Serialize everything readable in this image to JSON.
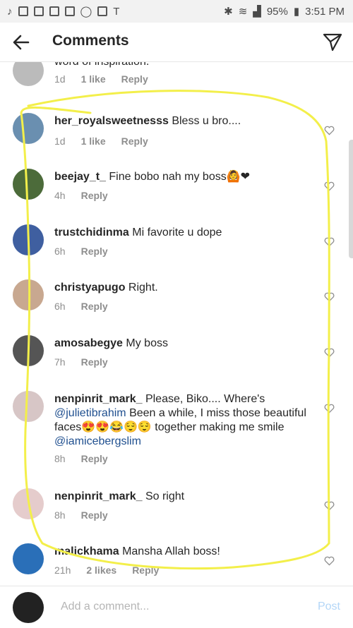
{
  "status_bar": {
    "battery": "95%",
    "time": "3:51 PM"
  },
  "header": {
    "title": "Comments"
  },
  "comments": [
    {
      "user": "",
      "text": "word of inspiration.",
      "time": "1d",
      "likes": "1 like",
      "reply": "Reply"
    },
    {
      "user": "her_royalsweetnesss",
      "text": "Bless u bro....",
      "time": "1d",
      "likes": "1 like",
      "reply": "Reply"
    },
    {
      "user": "beejay_t_",
      "text": "Fine bobo nah my boss🙆❤",
      "time": "4h",
      "likes": "",
      "reply": "Reply"
    },
    {
      "user": "trustchidinma",
      "text": "Mi favorite u dope",
      "time": "6h",
      "likes": "",
      "reply": "Reply"
    },
    {
      "user": "christyapugo",
      "text": "Right.",
      "time": "6h",
      "likes": "",
      "reply": "Reply"
    },
    {
      "user": "amosabegye",
      "text": "My boss",
      "time": "7h",
      "likes": "",
      "reply": "Reply"
    },
    {
      "user": "nenpinrit_mark_",
      "text1": "Please, Biko.... Where's",
      "mention1": "@julietibrahim",
      "text2": "Been a while, I miss those beautiful faces😍😍😂😌😌 together making me smile",
      "mention2": "@iamicebergslim",
      "time": "8h",
      "likes": "",
      "reply": "Reply"
    },
    {
      "user": "nenpinrit_mark_",
      "text": "So right",
      "time": "8h",
      "likes": "",
      "reply": "Reply"
    },
    {
      "user": "malickhama",
      "text": "Mansha Allah boss!",
      "time": "21h",
      "likes": "2 likes",
      "reply": "Reply"
    }
  ],
  "composer": {
    "placeholder": "Add a comment...",
    "post_label": "Post"
  },
  "colors": {
    "link": "#1f4f8f",
    "meta": "#8e8e8e",
    "post_disabled": "#b3d6f7",
    "annotation": "#f3ef4a"
  }
}
